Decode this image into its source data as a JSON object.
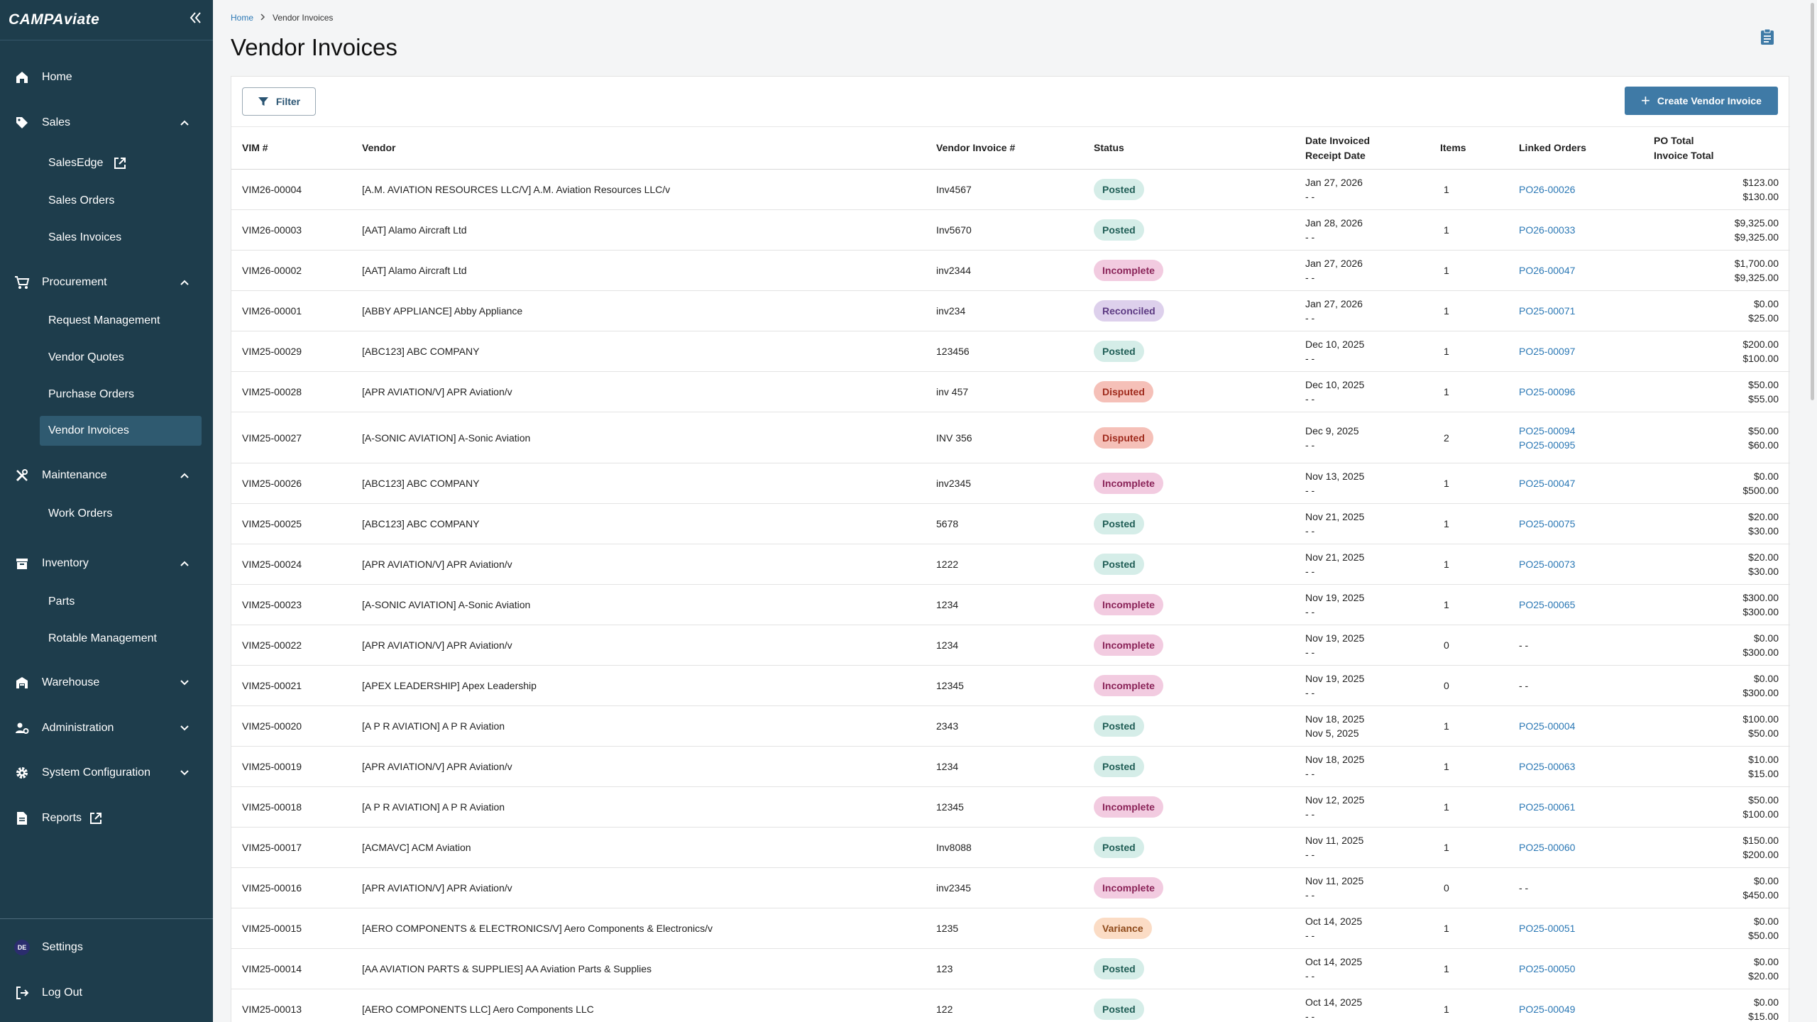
{
  "app": {
    "logo": "CAMPAviate"
  },
  "sidebar": {
    "home": "Home",
    "sales": {
      "label": "Sales",
      "items": [
        "SalesEdge",
        "Sales Orders",
        "Sales Invoices"
      ]
    },
    "procurement": {
      "label": "Procurement",
      "items": [
        "Request Management",
        "Vendor Quotes",
        "Purchase Orders",
        "Vendor Invoices"
      ]
    },
    "maintenance": {
      "label": "Maintenance",
      "items": [
        "Work Orders"
      ]
    },
    "inventory": {
      "label": "Inventory",
      "items": [
        "Parts",
        "Rotable Management"
      ]
    },
    "warehouse": "Warehouse",
    "administration": "Administration",
    "system_configuration": "System Configuration",
    "reports": "Reports",
    "settings": "Settings",
    "avatar_initials": "DE",
    "logout": "Log Out"
  },
  "breadcrumb": {
    "home": "Home",
    "current": "Vendor Invoices"
  },
  "page": {
    "title": "Vendor Invoices"
  },
  "toolbar": {
    "filter": "Filter",
    "create": "Create Vendor Invoice"
  },
  "table": {
    "headers": {
      "vim": "VIM #",
      "vendor": "Vendor",
      "vendor_invoice": "Vendor Invoice #",
      "status": "Status",
      "date_invoiced": "Date Invoiced",
      "receipt_date": "Receipt Date",
      "items": "Items",
      "linked_orders": "Linked Orders",
      "po_total": "PO Total",
      "invoice_total": "Invoice Total"
    },
    "rows": [
      {
        "vim": "VIM26-00004",
        "vendor": "[A.M. AVIATION RESOURCES LLC/V] A.M. Aviation Resources LLC/v",
        "inv": "Inv4567",
        "status": "Posted",
        "date": "Jan 27, 2026",
        "receipt": "- -",
        "items": "1",
        "orders": [
          "PO26-00026"
        ],
        "po_total": "$123.00",
        "inv_total": "$130.00"
      },
      {
        "vim": "VIM26-00003",
        "vendor": "[AAT] Alamo Aircraft Ltd",
        "inv": "Inv5670",
        "status": "Posted",
        "date": "Jan 28, 2026",
        "receipt": "- -",
        "items": "1",
        "orders": [
          "PO26-00033"
        ],
        "po_total": "$9,325.00",
        "inv_total": "$9,325.00"
      },
      {
        "vim": "VIM26-00002",
        "vendor": "[AAT] Alamo Aircraft Ltd",
        "inv": "inv2344",
        "status": "Incomplete",
        "date": "Jan 27, 2026",
        "receipt": "- -",
        "items": "1",
        "orders": [
          "PO26-00047"
        ],
        "po_total": "$1,700.00",
        "inv_total": "$9,325.00"
      },
      {
        "vim": "VIM26-00001",
        "vendor": "[ABBY APPLIANCE] Abby Appliance",
        "inv": "inv234",
        "status": "Reconciled",
        "date": "Jan 27, 2026",
        "receipt": "- -",
        "items": "1",
        "orders": [
          "PO25-00071"
        ],
        "po_total": "$0.00",
        "inv_total": "$25.00"
      },
      {
        "vim": "VIM25-00029",
        "vendor": "[ABC123] ABC COMPANY",
        "inv": "123456",
        "status": "Posted",
        "date": "Dec 10, 2025",
        "receipt": "- -",
        "items": "1",
        "orders": [
          "PO25-00097"
        ],
        "po_total": "$200.00",
        "inv_total": "$100.00"
      },
      {
        "vim": "VIM25-00028",
        "vendor": "[APR AVIATION/V] APR Aviation/v",
        "inv": "inv 457",
        "status": "Disputed",
        "date": "Dec 10, 2025",
        "receipt": "- -",
        "items": "1",
        "orders": [
          "PO25-00096"
        ],
        "po_total": "$50.00",
        "inv_total": "$55.00"
      },
      {
        "vim": "VIM25-00027",
        "vendor": "[A-SONIC AVIATION] A-Sonic Aviation",
        "inv": "INV 356",
        "status": "Disputed",
        "date": "Dec 9, 2025",
        "receipt": "- -",
        "items": "2",
        "orders": [
          "PO25-00094",
          "PO25-00095"
        ],
        "po_total": "$50.00",
        "inv_total": "$60.00"
      },
      {
        "vim": "VIM25-00026",
        "vendor": "[ABC123] ABC COMPANY",
        "inv": "inv2345",
        "status": "Incomplete",
        "date": "Nov 13, 2025",
        "receipt": "- -",
        "items": "1",
        "orders": [
          "PO25-00047"
        ],
        "po_total": "$0.00",
        "inv_total": "$500.00"
      },
      {
        "vim": "VIM25-00025",
        "vendor": "[ABC123] ABC COMPANY",
        "inv": "5678",
        "status": "Posted",
        "date": "Nov 21, 2025",
        "receipt": "- -",
        "items": "1",
        "orders": [
          "PO25-00075"
        ],
        "po_total": "$20.00",
        "inv_total": "$30.00"
      },
      {
        "vim": "VIM25-00024",
        "vendor": "[APR AVIATION/V] APR Aviation/v",
        "inv": "1222",
        "status": "Posted",
        "date": "Nov 21, 2025",
        "receipt": "- -",
        "items": "1",
        "orders": [
          "PO25-00073"
        ],
        "po_total": "$20.00",
        "inv_total": "$30.00"
      },
      {
        "vim": "VIM25-00023",
        "vendor": "[A-SONIC AVIATION] A-Sonic Aviation",
        "inv": "1234",
        "status": "Incomplete",
        "date": "Nov 19, 2025",
        "receipt": "- -",
        "items": "1",
        "orders": [
          "PO25-00065"
        ],
        "po_total": "$300.00",
        "inv_total": "$300.00"
      },
      {
        "vim": "VIM25-00022",
        "vendor": "[APR AVIATION/V] APR Aviation/v",
        "inv": "1234",
        "status": "Incomplete",
        "date": "Nov 19, 2025",
        "receipt": "- -",
        "items": "0",
        "orders": [],
        "po_total": "$0.00",
        "inv_total": "$300.00"
      },
      {
        "vim": "VIM25-00021",
        "vendor": "[APEX LEADERSHIP] Apex Leadership",
        "inv": "12345",
        "status": "Incomplete",
        "date": "Nov 19, 2025",
        "receipt": "- -",
        "items": "0",
        "orders": [],
        "po_total": "$0.00",
        "inv_total": "$300.00"
      },
      {
        "vim": "VIM25-00020",
        "vendor": "[A P R AVIATION] A P R Aviation",
        "inv": "2343",
        "status": "Posted",
        "date": "Nov 18, 2025",
        "receipt": "Nov 5, 2025",
        "items": "1",
        "orders": [
          "PO25-00004"
        ],
        "po_total": "$100.00",
        "inv_total": "$50.00"
      },
      {
        "vim": "VIM25-00019",
        "vendor": "[APR AVIATION/V] APR Aviation/v",
        "inv": "1234",
        "status": "Posted",
        "date": "Nov 18, 2025",
        "receipt": "- -",
        "items": "1",
        "orders": [
          "PO25-00063"
        ],
        "po_total": "$10.00",
        "inv_total": "$15.00"
      },
      {
        "vim": "VIM25-00018",
        "vendor": "[A P R AVIATION] A P R Aviation",
        "inv": "12345",
        "status": "Incomplete",
        "date": "Nov 12, 2025",
        "receipt": "- -",
        "items": "1",
        "orders": [
          "PO25-00061"
        ],
        "po_total": "$50.00",
        "inv_total": "$100.00"
      },
      {
        "vim": "VIM25-00017",
        "vendor": "[ACMAVC] ACM Aviation",
        "inv": "Inv8088",
        "status": "Posted",
        "date": "Nov 11, 2025",
        "receipt": "- -",
        "items": "1",
        "orders": [
          "PO25-00060"
        ],
        "po_total": "$150.00",
        "inv_total": "$200.00"
      },
      {
        "vim": "VIM25-00016",
        "vendor": "[APR AVIATION/V] APR Aviation/v",
        "inv": "inv2345",
        "status": "Incomplete",
        "date": "Nov 11, 2025",
        "receipt": "- -",
        "items": "0",
        "orders": [],
        "po_total": "$0.00",
        "inv_total": "$450.00"
      },
      {
        "vim": "VIM25-00015",
        "vendor": "[AERO COMPONENTS & ELECTRONICS/V] Aero Components & Electronics/v",
        "inv": "1235",
        "status": "Variance",
        "date": "Oct 14, 2025",
        "receipt": "- -",
        "items": "1",
        "orders": [
          "PO25-00051"
        ],
        "po_total": "$0.00",
        "inv_total": "$50.00"
      },
      {
        "vim": "VIM25-00014",
        "vendor": "[AA AVIATION PARTS & SUPPLIES] AA Aviation Parts & Supplies",
        "inv": "123",
        "status": "Posted",
        "date": "Oct 14, 2025",
        "receipt": "- -",
        "items": "1",
        "orders": [
          "PO25-00050"
        ],
        "po_total": "$0.00",
        "inv_total": "$20.00"
      },
      {
        "vim": "VIM25-00013",
        "vendor": "[AERO COMPONENTS LLC] Aero Components LLC",
        "inv": "122",
        "status": "Posted",
        "date": "Oct 14, 2025",
        "receipt": "- -",
        "items": "1",
        "orders": [
          "PO25-00049"
        ],
        "po_total": "$0.00",
        "inv_total": "$15.00"
      }
    ],
    "empty_orders": "- -"
  },
  "colors": {
    "sidebar_bg": "#1e3d4c",
    "active_item": "#2f5a70",
    "primary_button": "#3f7aa6",
    "link": "#2b78b5"
  },
  "icons": {
    "home": "home-icon",
    "sales": "tag-icon",
    "procurement": "cart-icon",
    "maintenance": "tools-icon",
    "inventory": "archive-icon",
    "warehouse": "warehouse-icon",
    "administration": "user-cog-icon",
    "system_configuration": "gear-icon",
    "reports": "document-icon",
    "logout": "logout-icon",
    "filter": "filter-icon",
    "create": "plus-icon",
    "collapse": "double-chevron-left-icon",
    "page_action": "clipboard-icon"
  }
}
